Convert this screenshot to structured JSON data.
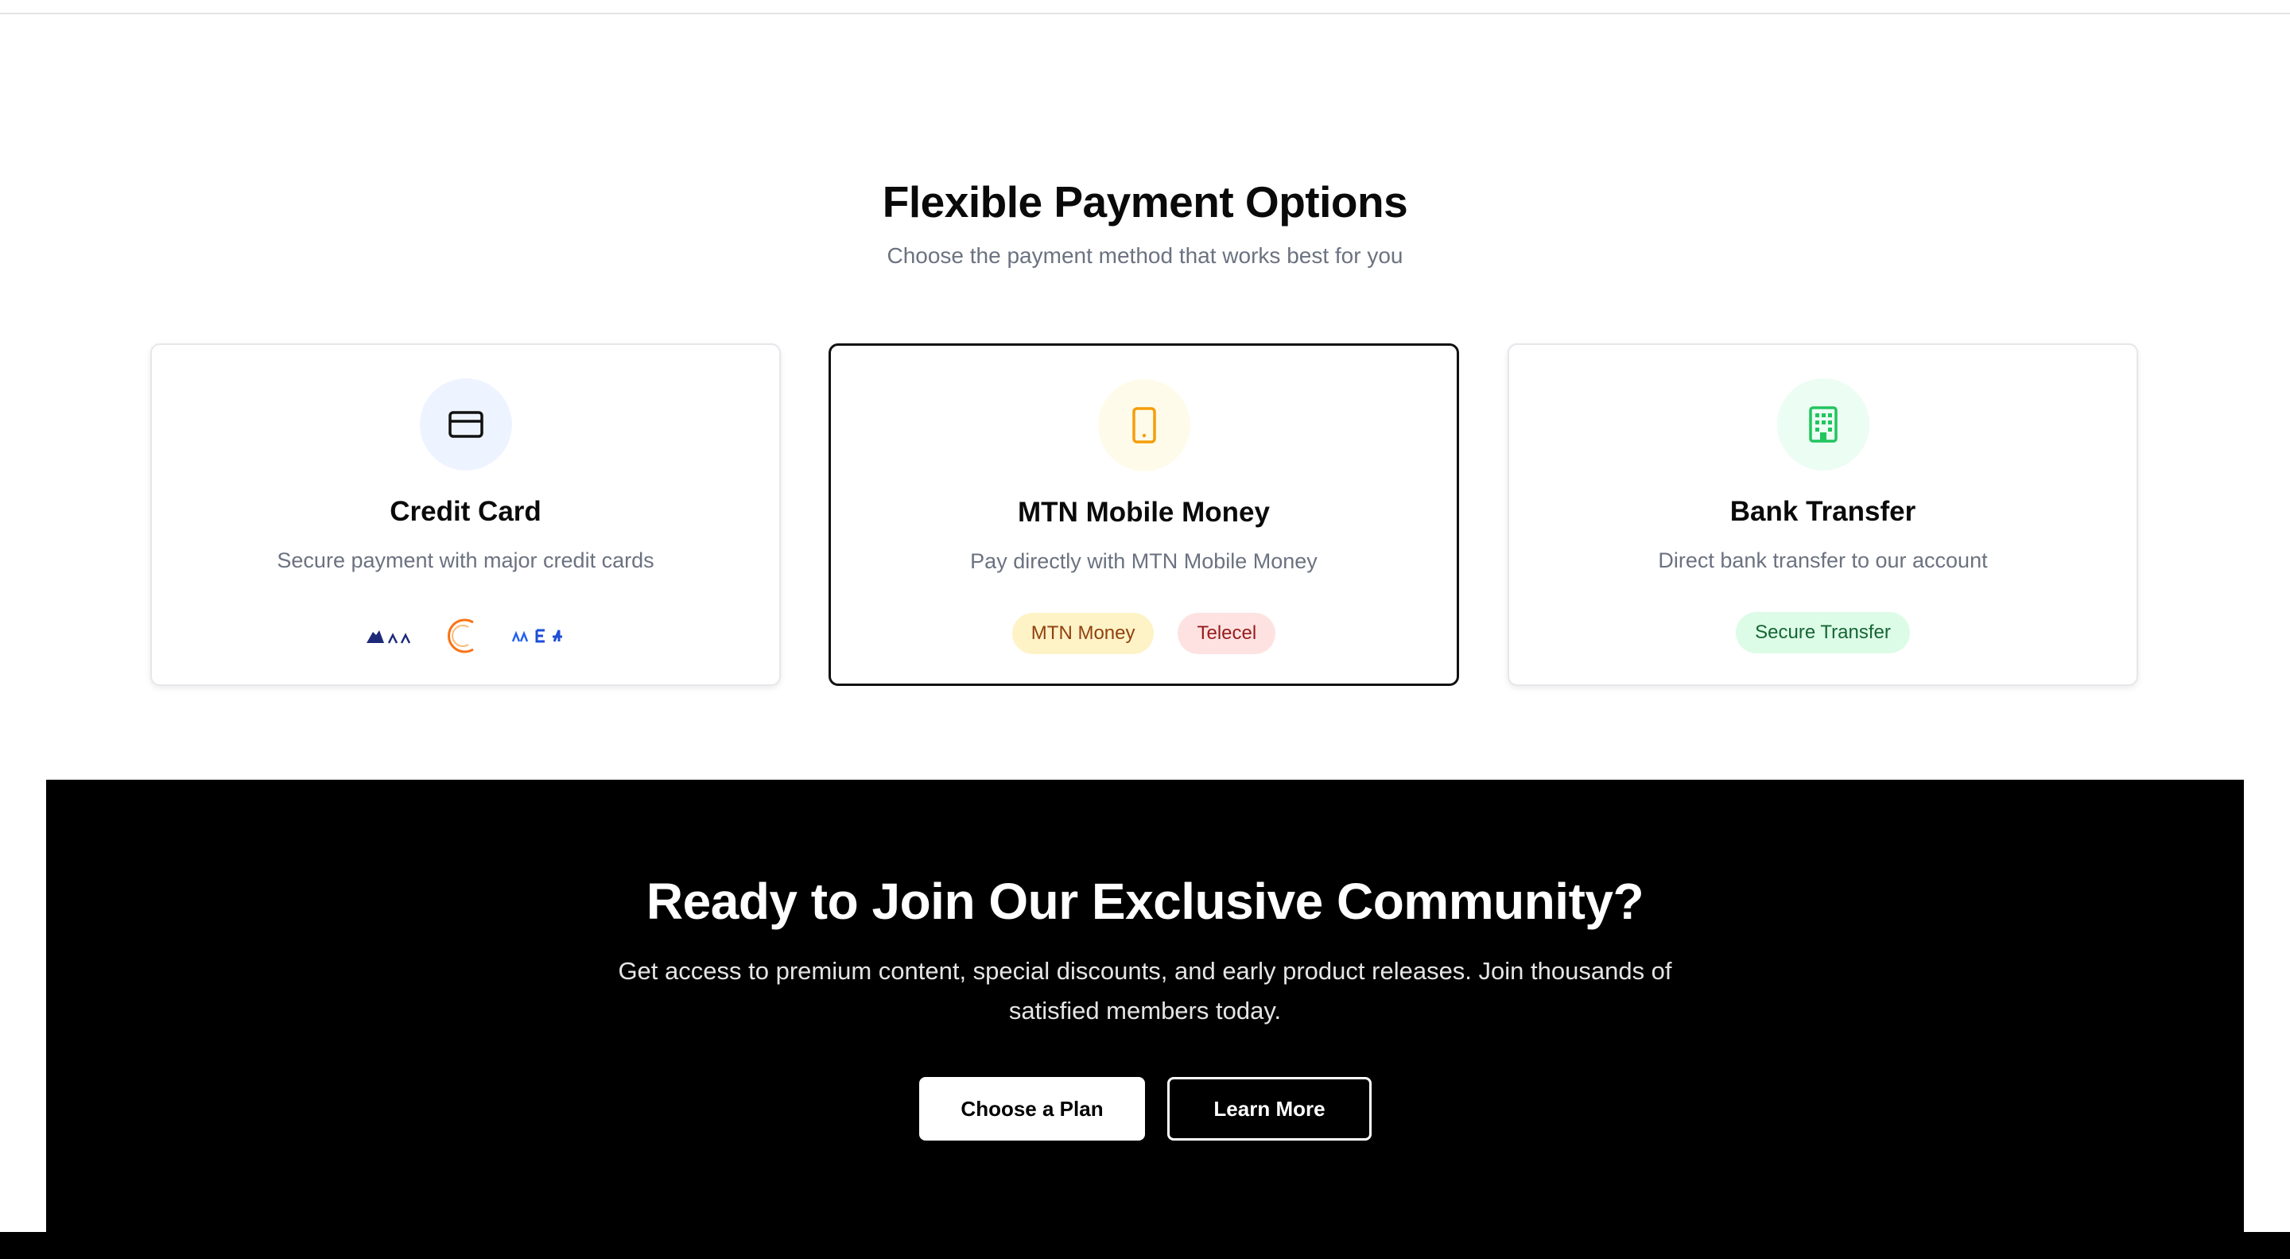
{
  "payment": {
    "title": "Flexible Payment Options",
    "subtitle": "Choose the payment method that works best for you",
    "cards": [
      {
        "icon": "credit-card-icon",
        "title": "Credit Card",
        "description": "Secure payment with major credit cards",
        "logos": [
          "card-network-logo",
          "card-network-logo",
          "card-network-logo"
        ]
      },
      {
        "icon": "smartphone-icon",
        "title": "MTN Mobile Money",
        "description": "Pay directly with MTN Mobile Money",
        "badges": [
          "MTN Money",
          "Telecel"
        ],
        "selected": true
      },
      {
        "icon": "building-icon",
        "title": "Bank Transfer",
        "description": "Direct bank transfer to our account",
        "badges": [
          "Secure Transfer"
        ]
      }
    ]
  },
  "cta": {
    "title": "Ready to Join Our Exclusive Community?",
    "text": "Get access to premium content, special discounts, and early product releases. Join thousands of satisfied members today.",
    "primary_button": "Choose a Plan",
    "secondary_button": "Learn More"
  },
  "colors": {
    "accent_yellow": "#f59e0b",
    "accent_green": "#22c55e",
    "accent_blue": "#eef4ff",
    "cta_background": "#000000"
  }
}
